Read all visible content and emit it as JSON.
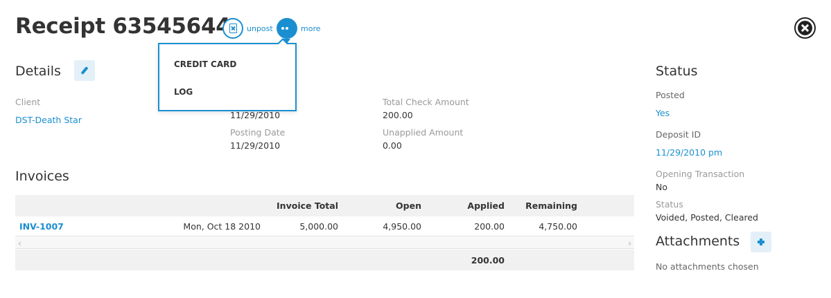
{
  "header": {
    "title": "Receipt 63545644",
    "unpost_label": "unpost",
    "more_label": "more"
  },
  "menu": {
    "items": [
      "CREDIT CARD",
      "LOG"
    ]
  },
  "details": {
    "heading": "Details",
    "client_label": "Client",
    "client_value": "DST-Death Star",
    "date_value": "11/29/2010",
    "posting_date_label": "Posting Date",
    "posting_date_value": "11/29/2010",
    "total_check_label": "Total Check Amount",
    "total_check_value": "200.00",
    "unapplied_label": "Unapplied Amount",
    "unapplied_value": "0.00"
  },
  "invoices": {
    "heading": "Invoices",
    "columns": [
      "Invoice Total",
      "Open",
      "Applied",
      "Remaining"
    ],
    "rows": [
      {
        "invoice": "INV-1007",
        "date": "Mon, Oct 18 2010",
        "total": "5,000.00",
        "open": "4,950.00",
        "applied": "200.00",
        "remaining": "4,750.00"
      }
    ],
    "footer_applied_total": "200.00"
  },
  "status": {
    "heading": "Status",
    "posted_label": "Posted",
    "posted_value": "Yes",
    "deposit_label": "Deposit ID",
    "deposit_value": "11/29/2010 pm",
    "opening_label": "Opening Transaction",
    "opening_value": "No",
    "status_label": "Status",
    "status_value": "Voided, Posted, Cleared"
  },
  "attachments": {
    "heading": "Attachments",
    "empty_text": "No attachments chosen"
  },
  "icons": {
    "unpost": "unpost-document-icon",
    "more": "ellipsis-icon",
    "close": "close-icon",
    "edit": "pencil-icon",
    "add": "plus-icon",
    "scroll_left": "chevron-left-icon",
    "scroll_right": "chevron-right-icon"
  },
  "colors": {
    "accent": "#1a8fd0",
    "button_bg": "#e3f0f8",
    "table_header_bg": "#f1f1f1"
  }
}
